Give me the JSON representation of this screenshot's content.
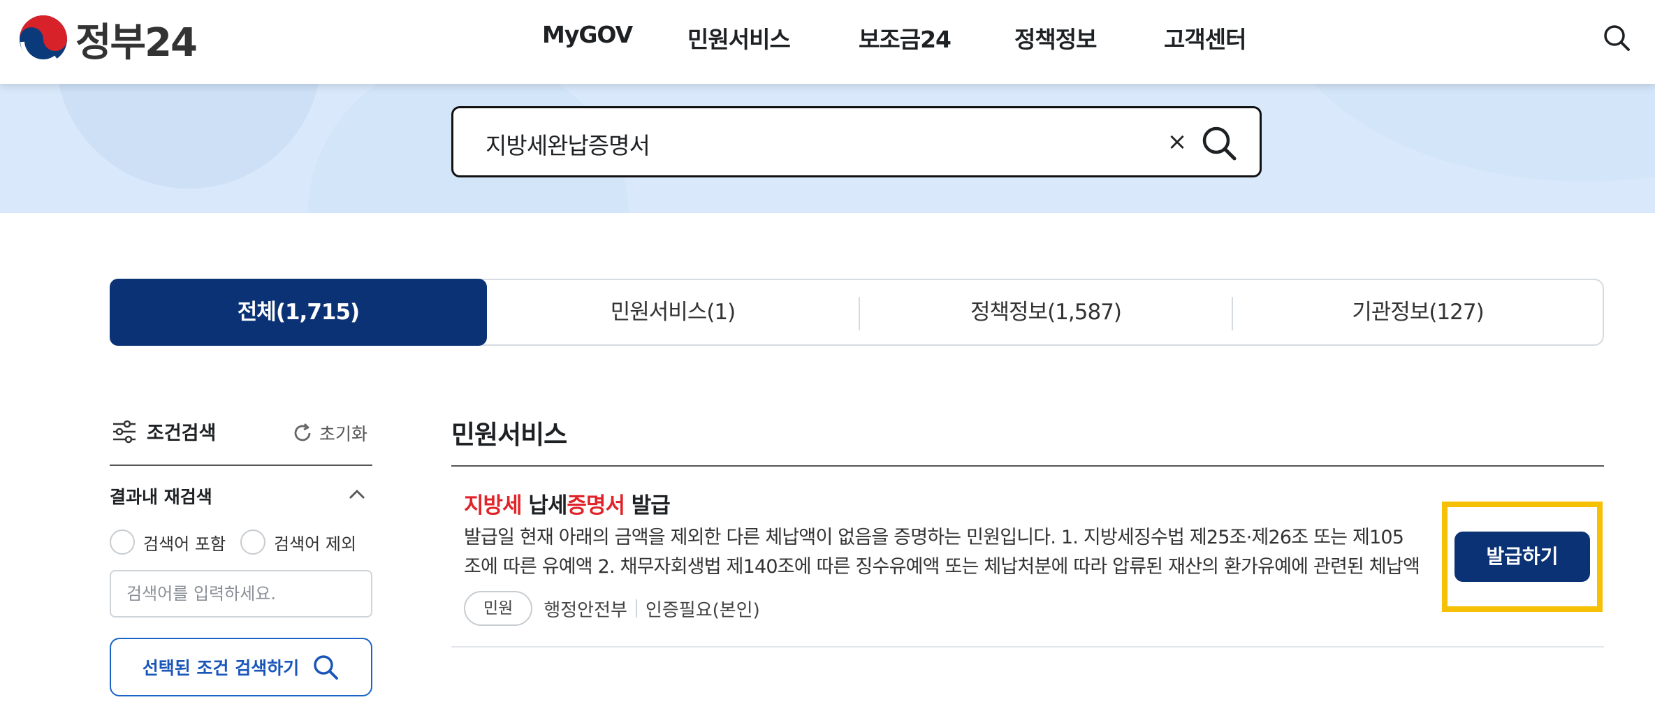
{
  "header": {
    "logo_text": "정부24",
    "nav": [
      {
        "label": "MyGOV"
      },
      {
        "label": "민원서비스"
      },
      {
        "label": "보조금24"
      },
      {
        "label": "정책정보"
      },
      {
        "label": "고객센터"
      }
    ]
  },
  "search": {
    "value": "지방세완납증명서",
    "clear_label": "×"
  },
  "tabs": [
    {
      "label": "전체(1,715)",
      "active": true
    },
    {
      "label": "민원서비스(1)",
      "active": false
    },
    {
      "label": "정책정보(1,587)",
      "active": false
    },
    {
      "label": "기관정보(127)",
      "active": false
    }
  ],
  "sidebar": {
    "filter_title": "조건검색",
    "reset_label": "초기화",
    "research_title": "결과내 재검색",
    "include_label": "검색어 포함",
    "exclude_label": "검색어 제외",
    "input_placeholder": "검색어를 입력하세요.",
    "search_button": "선택된 조건 검색하기"
  },
  "results": {
    "section_title": "민원서비스",
    "item": {
      "title_parts": [
        "지방세",
        " 납세",
        "증명서",
        " 발급"
      ],
      "desc_line1": "발급일 현재 아래의 금액을 제외한 다른 체납액이 없음을 증명하는 민원입니다. 1. 지방세징수법 제25조·제26조 또는 제105",
      "desc_line2": "조에 따른 유예액 2. 채무자회생법 제140조에 따른 징수유예액 또는 체납처분에 따라 압류된 재산의 환가유예에 관련된 체납액",
      "badge": "민원",
      "agency": "행정안전부",
      "auth": "인증필요(본인)",
      "issue_button": "발급하기"
    }
  },
  "colors": {
    "primary": "#0b3275",
    "highlight": "#e0242a",
    "outline": "#f5c006",
    "banner": "#d9e9fb"
  },
  "icons": [
    "taegeuk-logo-icon",
    "search-icon",
    "close-icon",
    "filter-icon",
    "refresh-icon",
    "chevron-up-icon"
  ]
}
